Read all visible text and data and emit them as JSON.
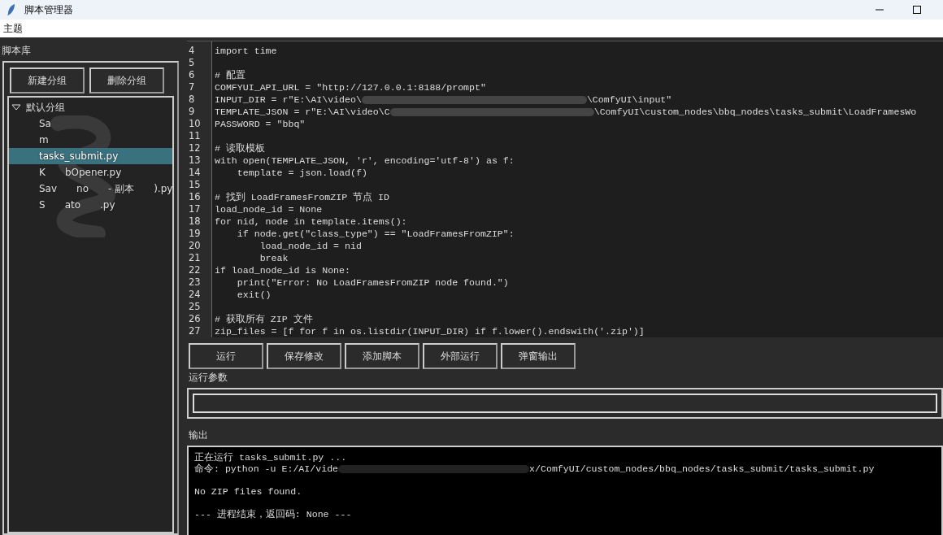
{
  "window": {
    "title": "脚本管理器"
  },
  "menu": [
    "主题"
  ],
  "library": {
    "label": "脚本库",
    "buttons": [
      "新建分组",
      "删除分组"
    ],
    "tree": {
      "label": "默认分组",
      "expanded": true,
      "children": [
        {
          "parts": [
            "Sa"
          ],
          "selected": false
        },
        {
          "parts": [
            "m"
          ],
          "selected": false
        },
        {
          "parts": [
            "tasks_submit.py"
          ],
          "selected": true
        },
        {
          "parts": [
            "K",
            "bOpener.py"
          ],
          "selected": false
        },
        {
          "parts": [
            "Sav",
            "no",
            "- 副本",
            ").py"
          ],
          "selected": false
        },
        {
          "parts": [
            "S",
            "ato",
            ".py"
          ],
          "selected": false
        }
      ]
    }
  },
  "editor": {
    "lines": [
      {
        "number": "4",
        "parts": [
          "import time"
        ]
      },
      {
        "number": "5"
      },
      {
        "number": "6",
        "parts": [
          "# 配置"
        ]
      },
      {
        "number": "7",
        "parts": [
          "COMFYUI_API_URL = \"http://127.0.0.1:8188/prompt\""
        ]
      },
      {
        "number": "8",
        "parts": [
          "INPUT_DIR = r\"E:\\AI\\video\\",
          "\\ComfyUI\\input\""
        ]
      },
      {
        "number": "9",
        "parts": [
          "TEMPLATE_JSON = r\"E:\\AI\\video\\C",
          "\\ComfyUI\\custom_nodes\\bbq_nodes\\tasks_submit\\LoadFramesWo"
        ]
      },
      {
        "number": "10",
        "parts": [
          "PASSWORD = \"bbq\""
        ]
      },
      {
        "number": "11"
      },
      {
        "number": "12",
        "parts": [
          "# 读取模板"
        ]
      },
      {
        "number": "13",
        "parts": [
          "with open(TEMPLATE_JSON, 'r', encoding='utf-8') as f:"
        ]
      },
      {
        "number": "14",
        "parts": [
          "    template = json.load(f)"
        ]
      },
      {
        "number": "15"
      },
      {
        "number": "16",
        "parts": [
          "# 找到 LoadFramesFromZIP 节点 ID"
        ]
      },
      {
        "number": "17",
        "parts": [
          "load_node_id = None"
        ]
      },
      {
        "number": "18",
        "parts": [
          "for nid, node in template.items():"
        ]
      },
      {
        "number": "19",
        "parts": [
          "    if node.get(\"class_type\") == \"LoadFramesFromZIP\":"
        ]
      },
      {
        "number": "20",
        "parts": [
          "        load_node_id = nid"
        ]
      },
      {
        "number": "21",
        "parts": [
          "        break"
        ]
      },
      {
        "number": "22",
        "parts": [
          "if load_node_id is None:"
        ]
      },
      {
        "number": "23",
        "parts": [
          "    print(\"Error: No LoadFramesFromZIP node found.\")"
        ]
      },
      {
        "number": "24",
        "parts": [
          "    exit()"
        ]
      },
      {
        "number": "25"
      },
      {
        "number": "26",
        "parts": [
          "# 获取所有 ZIP 文件"
        ]
      },
      {
        "number": "27",
        "parts": [
          "zip_files = [f for f in os.listdir(INPUT_DIR) if f.lower().endswith('.zip')]"
        ]
      }
    ]
  },
  "actions": [
    "运行",
    "保存修改",
    "添加脚本",
    "外部运行",
    "弹窗输出"
  ],
  "args": {
    "label": "运行参数"
  },
  "output": {
    "label": "输出",
    "lines": [
      {
        "parts": [
          "正在运行 tasks_submit.py ..."
        ]
      },
      {
        "parts": [
          "命令: python -u E:/AI/vide",
          "x/ComfyUI/custom_nodes/bbq_nodes/tasks_submit/tasks_submit.py"
        ]
      },
      {
        "parts": [
          "No ZIP files found."
        ],
        "blank_before": true
      },
      {
        "parts": [
          "--- 进程结束，返回码: None ---"
        ],
        "blank_before": true
      }
    ]
  }
}
